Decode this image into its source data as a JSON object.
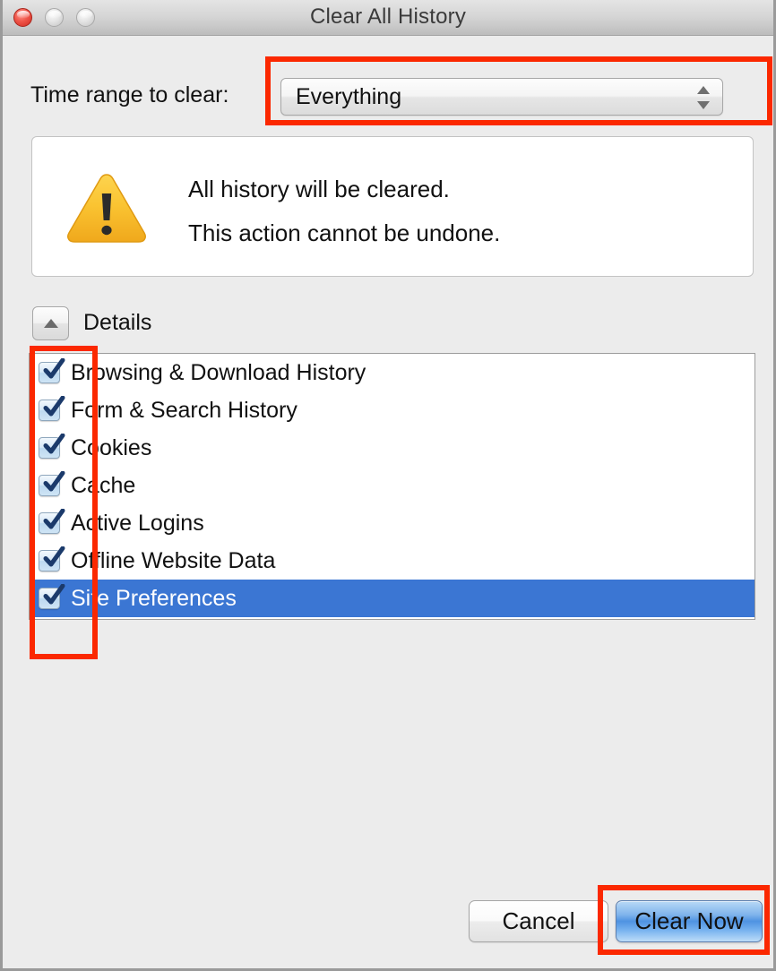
{
  "window": {
    "title": "Clear All History",
    "traffic_lights": [
      {
        "name": "close",
        "color": "#e5463a",
        "active": true
      },
      {
        "name": "minimize",
        "color": "#d9d9d9",
        "active": false
      },
      {
        "name": "zoom",
        "color": "#d9d9d9",
        "active": false
      }
    ]
  },
  "time_range": {
    "label": "Time range to clear:",
    "selected_value": "Everything",
    "options": [
      "Everything"
    ]
  },
  "warning": {
    "icon": "warning-triangle-icon",
    "line1": "All history will be cleared.",
    "line2": "This action cannot be undone."
  },
  "details": {
    "label": "Details",
    "expanded": true,
    "toggle_icon": "triangle-up-icon"
  },
  "options": [
    {
      "label": "Browsing & Download History",
      "checked": true,
      "selected": false
    },
    {
      "label": "Form & Search History",
      "checked": true,
      "selected": false
    },
    {
      "label": "Cookies",
      "checked": true,
      "selected": false
    },
    {
      "label": "Cache",
      "checked": true,
      "selected": false
    },
    {
      "label": "Active Logins",
      "checked": true,
      "selected": false
    },
    {
      "label": "Offline Website Data",
      "checked": true,
      "selected": false
    },
    {
      "label": "Site Preferences",
      "checked": true,
      "selected": true
    }
  ],
  "buttons": {
    "cancel": "Cancel",
    "clear_now": "Clear Now"
  },
  "annotations": {
    "color": "#fb2800",
    "boxes": [
      {
        "name": "time-range-dropdown"
      },
      {
        "name": "checkbox-column"
      },
      {
        "name": "clear-now-button"
      }
    ]
  },
  "colors": {
    "window_background": "#ececec",
    "panel_background": "#ffffff",
    "selection_blue": "#3b76d3",
    "default_button_blue": "#4f93e2",
    "warning_yellow": "#f7c033",
    "annotation_red": "#fb2800"
  }
}
